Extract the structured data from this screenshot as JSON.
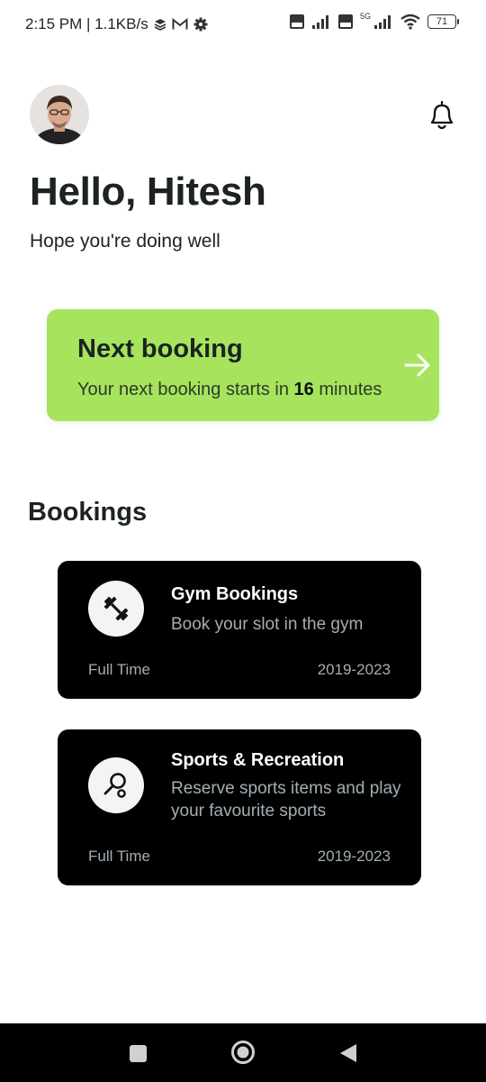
{
  "status_bar": {
    "time_speed": "2:15 PM | 1.1KB/s",
    "battery": "71",
    "network_5g": "5G"
  },
  "header": {
    "greeting": "Hello, Hitesh",
    "subtitle": "Hope you're doing well"
  },
  "next_booking": {
    "title": "Next booking",
    "text_prefix": "Your next booking starts in ",
    "minutes": "16",
    "text_suffix": " minutes",
    "card_color": "#a6e45d"
  },
  "bookings": {
    "section_title": "Bookings",
    "cards": [
      {
        "title": "Gym Bookings",
        "description": "Book your slot in the gym",
        "tag": "Full Time",
        "years": "2019-2023",
        "icon": "dumbbell-icon"
      },
      {
        "title": "Sports & Recreation",
        "description": "Reserve sports items and play your favourite sports",
        "tag": "Full Time",
        "years": "2019-2023",
        "icon": "racket-icon"
      }
    ]
  },
  "colors": {
    "background": "#ffffff",
    "card_dark": "#000000",
    "muted_text": "#a3aeb4",
    "primary_text": "#1c2321"
  }
}
